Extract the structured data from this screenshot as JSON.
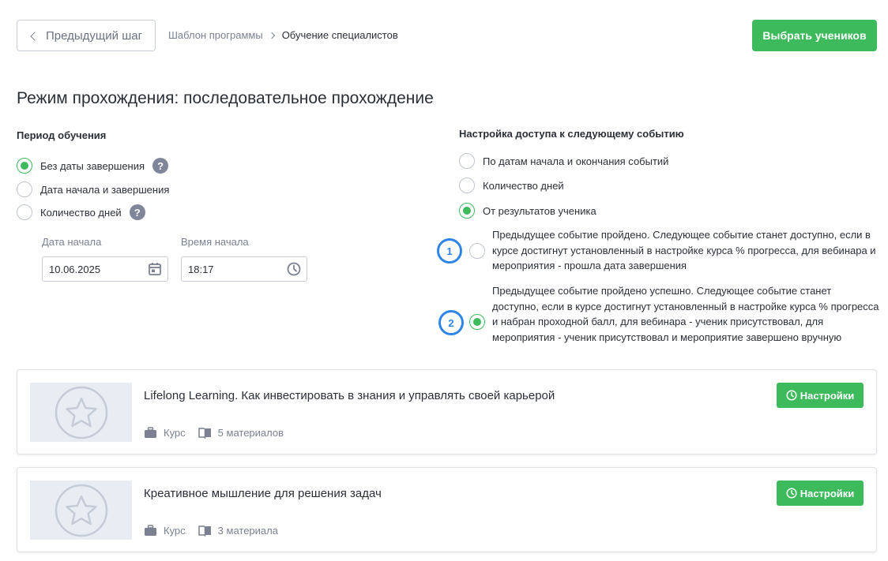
{
  "topbar": {
    "prev_label": "Предыдущий шаг",
    "breadcrumb": {
      "parent": "Шаблон программы",
      "current": "Обучение специалистов"
    },
    "select_label": "Выбрать учеников"
  },
  "page_title": "Режим прохождения: последовательное прохождение",
  "period": {
    "label": "Период обучения",
    "options": [
      {
        "label": "Без даты завершения",
        "checked": true,
        "help": true
      },
      {
        "label": "Дата начала и завершения",
        "checked": false,
        "help": false
      },
      {
        "label": "Количество дней",
        "checked": false,
        "help": true
      }
    ],
    "help_glyph": "?",
    "start_date": {
      "label": "Дата начала",
      "value": "10.06.2025",
      "icon": "calendar-icon"
    },
    "start_time": {
      "label": "Время начала",
      "value": "18:17",
      "icon": "clock-icon"
    }
  },
  "access": {
    "label": "Настройка доступа к следующему событию",
    "options": [
      {
        "label": "По датам начала и окончания событий",
        "checked": false
      },
      {
        "label": "Количество дней",
        "checked": false
      },
      {
        "label": "От результатов ученика",
        "checked": true
      }
    ],
    "sub_options": [
      {
        "badge": "1",
        "checked": false,
        "text": "Предыдущее событие пройдено. Следующее событие станет доступно, если в курсе достигнут установленный в настройке курса % прогресса, для вебинара и мероприятия - прошла дата завершения"
      },
      {
        "badge": "2",
        "checked": true,
        "text": "Предыдущее событие пройдено успешно. Следующее событие станет доступно, если в курсе достигнут установленный в настройке курса % прогресса и набран проходной балл, для вебинара - ученик присутствовал, для мероприятия - ученик присутствовал и мероприятие завершено вручную"
      }
    ]
  },
  "events": [
    {
      "title": "Lifelong Learning. Как инвестировать в знания и управлять своей карьерой",
      "type": "Курс",
      "materials": "5 материалов",
      "settings_label": "Настройки",
      "thumb_icon": "star-icon"
    },
    {
      "title": "Креативное мышление для решения задач",
      "type": "Курс",
      "materials": "3 материала",
      "settings_label": "Настройки",
      "thumb_icon": "star-icon"
    }
  ],
  "colors": {
    "accent": "#3dba5c",
    "badge": "#2f86e8",
    "text": "#2b2f38",
    "muted": "#7b8190"
  }
}
